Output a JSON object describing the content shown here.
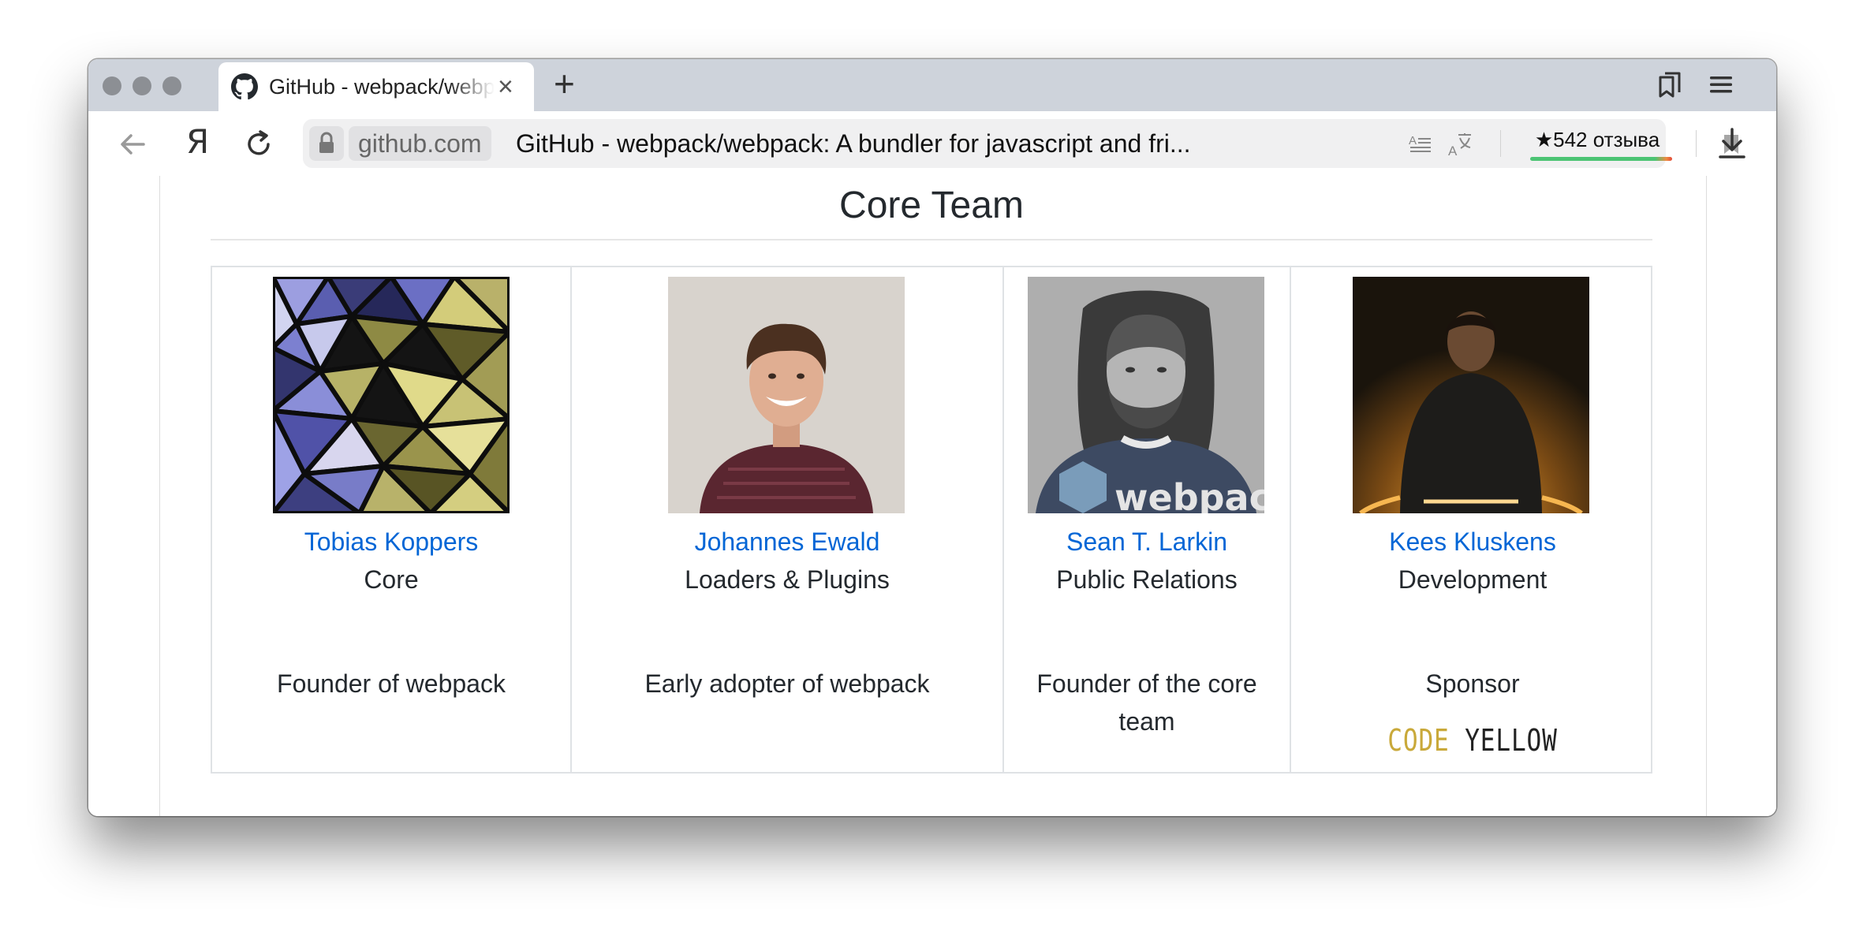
{
  "browser": {
    "tab_title": "GitHub - webpack/webpack: A bundler for javascript and friends",
    "new_tab_label": "+",
    "tab_close_label": "×",
    "address_domain": "github.com",
    "address_title": "GitHub - webpack/webpack: A bundler for javascript and fri...",
    "reviews_star": "★",
    "reviews_count": "542",
    "reviews_label": "отзыва",
    "logo_glyph": "Я"
  },
  "page": {
    "section_title": "Core Team",
    "members": [
      {
        "name": "Tobias Koppers",
        "role": "Core",
        "description": "Founder of webpack"
      },
      {
        "name": "Johannes Ewald",
        "role": "Loaders & Plugins",
        "description": "Early adopter of webpack"
      },
      {
        "name": "Sean T. Larkin",
        "role": "Public Relations",
        "description": "Founder of the core team"
      },
      {
        "name": "Kees Kluskens",
        "role": "Development",
        "description": "Sponsor",
        "sponsor_logo": {
          "word1": "CODE",
          "word2": "YELLOW"
        }
      }
    ]
  },
  "colors": {
    "link": "#0366d6",
    "text": "#24292e",
    "tabbar": "#ced3db",
    "code_yellow": "#c9a93a"
  }
}
